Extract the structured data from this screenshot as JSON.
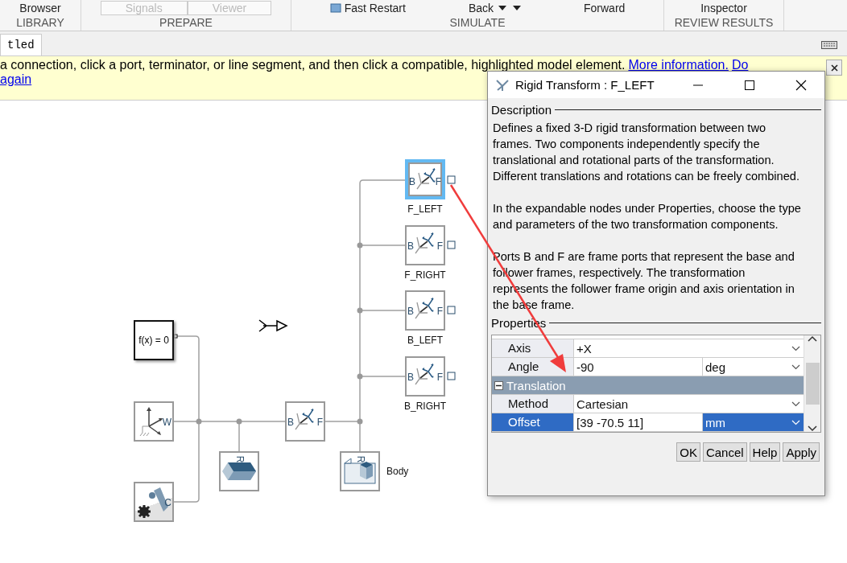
{
  "toolstrip": [
    {
      "label": "LIBRARY",
      "items": [
        {
          "label": "Browser",
          "disabled": false
        }
      ]
    },
    {
      "label": "PREPARE",
      "items": [
        {
          "label": "Signals",
          "disabled": true
        },
        {
          "label": "Viewer",
          "disabled": true
        }
      ]
    },
    {
      "label": "SIMULATE",
      "items": [
        {
          "label": "Fast Restart",
          "disabled": false
        },
        {
          "label": "Back",
          "disabled": false
        },
        {
          "label": "Forward",
          "disabled": false
        }
      ]
    },
    {
      "label": "REVIEW RESULTS",
      "items": [
        {
          "label": "Inspector",
          "disabled": false
        }
      ]
    }
  ],
  "tabs": [
    {
      "label": "tled",
      "selected": true
    }
  ],
  "info_bar": {
    "message": "a connection, click a port, terminator, or line segment, and then click a compatible, highlighted model element.",
    "links": [
      "More information.",
      "Do"
    ],
    "continuation": "again"
  },
  "diagram": {
    "blocks": [
      {
        "kind": "equation",
        "text": "f(x) = 0",
        "selected": false
      },
      {
        "kind": "world",
        "ports": [
          "W"
        ],
        "selected": false
      },
      {
        "kind": "config",
        "ports": [
          "C"
        ],
        "selected": false
      },
      {
        "kind": "solid",
        "ports": [
          "R"
        ],
        "selected": false
      },
      {
        "kind": "transform",
        "ports": [
          "B",
          "F"
        ],
        "selected": false
      },
      {
        "kind": "body",
        "ports": [
          "R"
        ],
        "label": "Body",
        "selected": false
      },
      {
        "kind": "transform",
        "ports": [
          "B",
          "F"
        ],
        "label": "F_LEFT",
        "selected": true
      },
      {
        "kind": "transform",
        "ports": [
          "B",
          "F"
        ],
        "label": "F_RIGHT",
        "selected": false
      },
      {
        "kind": "transform",
        "ports": [
          "B",
          "F"
        ],
        "label": "B_LEFT",
        "selected": false
      },
      {
        "kind": "transform",
        "ports": [
          "B",
          "F"
        ],
        "label": "B_RIGHT",
        "selected": false
      }
    ]
  },
  "dialog": {
    "title": "Rigid Transform : F_LEFT",
    "description_heading": "Description",
    "description": [
      "Defines a fixed 3-D rigid transformation between two frames. Two components independently specify the translational and rotational parts of the transformation. Different translations and rotations can be freely combined.",
      "In the expandable nodes under Properties, choose the type and parameters of the two transformation components.",
      "Ports B and F are frame ports that represent the base and follower frames, respectively. The transformation represents the follower frame origin and axis orientation in the base frame."
    ],
    "properties_heading": "Properties",
    "rows": [
      {
        "kind": "param",
        "name": "Axis",
        "value": "+X",
        "selected": false
      },
      {
        "kind": "param",
        "name": "Angle",
        "value": "-90",
        "unit": "deg",
        "selected": false
      },
      {
        "kind": "group",
        "name": "Translation",
        "expanded": true
      },
      {
        "kind": "param",
        "name": "Method",
        "value": "Cartesian",
        "selected": false
      },
      {
        "kind": "param",
        "name": "Offset",
        "value": "[39 -70.5 11]",
        "unit": "mm",
        "selected": true
      }
    ],
    "buttons": [
      "OK",
      "Cancel",
      "Help",
      "Apply"
    ]
  }
}
